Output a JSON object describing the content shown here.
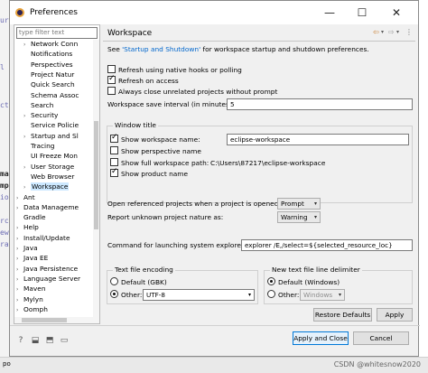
{
  "background": {
    "code_lines": [
      "ur",
      "l",
      "ct",
      "ma",
      "mp",
      "io",
      "rc",
      "ew",
      "ra"
    ],
    "tab_label": "po"
  },
  "window": {
    "title": "Preferences",
    "controls": {
      "minimize": "—",
      "maximize": "☐",
      "close": "✕"
    }
  },
  "tree": {
    "filter_placeholder": "type filter text",
    "items": [
      {
        "label": "Network Conn",
        "indent": 1,
        "arrow": "›"
      },
      {
        "label": "Notifications",
        "indent": 1,
        "arrow": ""
      },
      {
        "label": "Perspectives",
        "indent": 1,
        "arrow": ""
      },
      {
        "label": "Project Natur",
        "indent": 1,
        "arrow": ""
      },
      {
        "label": "Quick Search",
        "indent": 1,
        "arrow": ""
      },
      {
        "label": "Schema Assoc",
        "indent": 1,
        "arrow": ""
      },
      {
        "label": "Search",
        "indent": 1,
        "arrow": ""
      },
      {
        "label": "Security",
        "indent": 1,
        "arrow": "›"
      },
      {
        "label": "Service Policie",
        "indent": 1,
        "arrow": ""
      },
      {
        "label": "Startup and Sl",
        "indent": 1,
        "arrow": "›"
      },
      {
        "label": "Tracing",
        "indent": 1,
        "arrow": ""
      },
      {
        "label": "UI Freeze Mon",
        "indent": 1,
        "arrow": ""
      },
      {
        "label": "User Storage",
        "indent": 1,
        "arrow": "›"
      },
      {
        "label": "Web Browser",
        "indent": 1,
        "arrow": ""
      },
      {
        "label": "Workspace",
        "indent": 1,
        "arrow": "›",
        "selected": true
      },
      {
        "label": "Ant",
        "indent": 0,
        "arrow": "›"
      },
      {
        "label": "Data Manageme",
        "indent": 0,
        "arrow": "›"
      },
      {
        "label": "Gradle",
        "indent": 0,
        "arrow": ""
      },
      {
        "label": "Help",
        "indent": 0,
        "arrow": "›"
      },
      {
        "label": "Install/Update",
        "indent": 0,
        "arrow": "›"
      },
      {
        "label": "Java",
        "indent": 0,
        "arrow": "›"
      },
      {
        "label": "Java EE",
        "indent": 0,
        "arrow": "›"
      },
      {
        "label": "Java Persistence",
        "indent": 0,
        "arrow": "›"
      },
      {
        "label": "Language Server",
        "indent": 0,
        "arrow": "›"
      },
      {
        "label": "Maven",
        "indent": 0,
        "arrow": "›"
      },
      {
        "label": "Mylyn",
        "indent": 0,
        "arrow": "›"
      },
      {
        "label": "Oomph",
        "indent": 0,
        "arrow": "›"
      }
    ]
  },
  "page": {
    "title": "Workspace",
    "nav_icons": {
      "back": "⇦",
      "back_menu": "▾",
      "forward": "⇨",
      "forward_menu": "▾",
      "menu": "⋮"
    },
    "intro_prefix": "See ",
    "intro_link": "'Startup and Shutdown'",
    "intro_suffix": " for workspace startup and shutdown preferences.",
    "refresh_native": {
      "label": "Refresh using native hooks or polling",
      "checked": false
    },
    "refresh_access": {
      "label": "Refresh on access",
      "checked": true
    },
    "close_unrelated": {
      "label": "Always close unrelated projects without prompt",
      "checked": false
    },
    "save_interval": {
      "label": "Workspace save interval (in minutes):",
      "value": "5"
    },
    "window_title": {
      "group_label": "Window title",
      "show_name": {
        "label": "Show workspace name:",
        "checked": true,
        "value": "eclipse-workspace"
      },
      "show_perspective": {
        "label": "Show perspective name",
        "checked": false
      },
      "show_full_path": {
        "label": "Show full workspace path:",
        "checked": false,
        "value": "C:\\Users\\87217\\eclipse-workspace"
      },
      "show_product": {
        "label": "Show product name",
        "checked": true
      }
    },
    "open_project": {
      "label": "Open referenced projects when a project is opened:",
      "value": "Prompt"
    },
    "unknown_nature": {
      "label": "Report unknown project nature as:",
      "value": "Warning"
    },
    "explorer_cmd": {
      "label": "Command for launching system explorer:",
      "value": "explorer /E,/select=${selected_resource_loc}"
    },
    "text_encoding": {
      "group_label": "Text file encoding",
      "default_label": "Default (GBK)",
      "other_label": "Other:",
      "other_value": "UTF-8",
      "selected": "other"
    },
    "line_delimiter": {
      "group_label": "New text file line delimiter",
      "default_label": "Default (Windows)",
      "other_label": "Other:",
      "other_value": "Windows",
      "selected": "default"
    },
    "restore_defaults": "Restore Defaults",
    "apply": "Apply"
  },
  "bottom": {
    "icons": [
      "help-icon",
      "import-icon",
      "export-icon",
      "open-file-icon"
    ],
    "apply_close": "Apply and Close",
    "cancel": "Cancel"
  },
  "watermark": "CSDN @whitesnow2020"
}
